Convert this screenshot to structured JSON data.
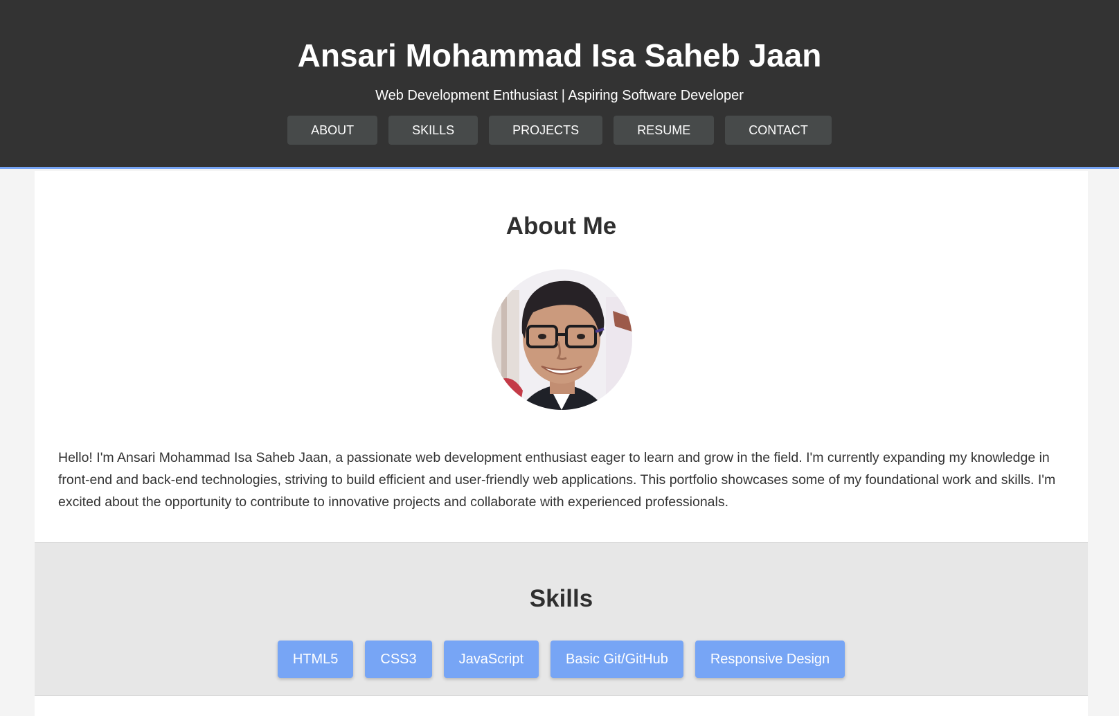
{
  "header": {
    "title": "Ansari Mohammad Isa Saheb Jaan",
    "tagline": "Web Development Enthusiast | Aspiring Software Developer",
    "nav": [
      {
        "label": "ABOUT"
      },
      {
        "label": "SKILLS"
      },
      {
        "label": "PROJECTS"
      },
      {
        "label": "RESUME"
      },
      {
        "label": "CONTACT"
      }
    ]
  },
  "about": {
    "heading": "About Me",
    "photo_icon": "profile-photo",
    "text": "Hello! I'm Ansari Mohammad Isa Saheb Jaan, a passionate web development enthusiast eager to learn and grow in the field. I'm currently expanding my knowledge in front-end and back-end technologies, striving to build efficient and user-friendly web applications. This portfolio showcases some of my foundational work and skills. I'm excited about the opportunity to contribute to innovative projects and collaborate with experienced professionals."
  },
  "skills": {
    "heading": "Skills",
    "items": [
      "HTML5",
      "CSS3",
      "JavaScript",
      "Basic Git/GitHub",
      "Responsive Design"
    ]
  },
  "colors": {
    "header_bg": "#333333",
    "nav_button_bg": "#474a4a",
    "accent": "#77a5f5",
    "page_bg": "#f4f4f4",
    "skills_bg": "#e7e7e7"
  }
}
